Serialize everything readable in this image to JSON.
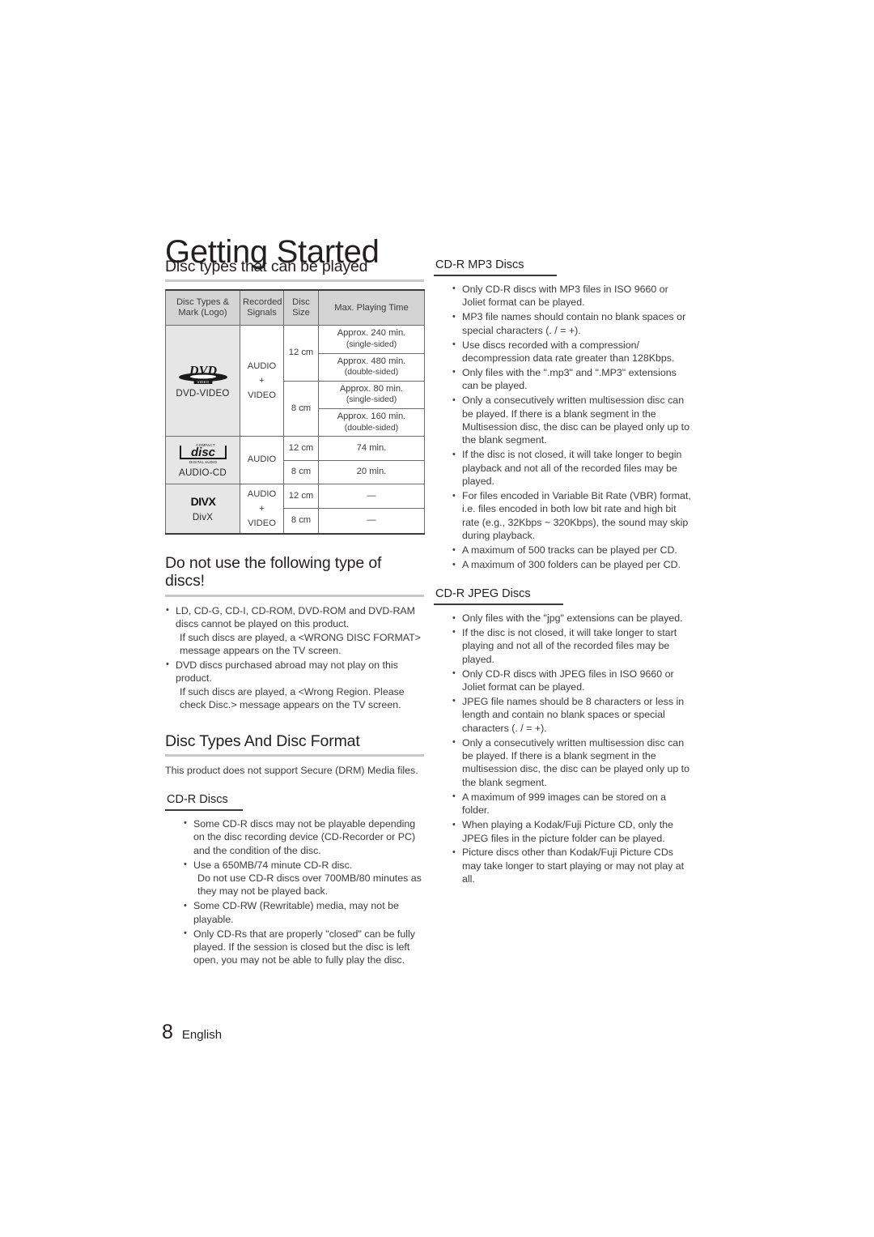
{
  "page": {
    "chapter_title": "Getting Started",
    "footer_page_number": "8",
    "footer_language": "English"
  },
  "left_column": {
    "heading_disc_types_played": "Disc types that can be played",
    "table": {
      "headers": [
        "Disc Types &\nMark (Logo)",
        "Recorded\nSignals",
        "Disc\nSize",
        "Max. Playing Time"
      ],
      "headers_flat": {
        "c1_line1": "Disc Types &",
        "c1_line2": "Mark (Logo)",
        "c2_line1": "Recorded",
        "c2_line2": "Signals",
        "c3_line1": "Disc",
        "c3_line2": "Size",
        "c4": "Max. Playing Time"
      },
      "rows": [
        {
          "logo": "dvd-video-logo",
          "logo_caption": "DVD-VIDEO",
          "signals_lines": [
            "AUDIO",
            "+",
            "VIDEO"
          ],
          "sizes": [
            {
              "size": "12 cm",
              "times": [
                {
                  "main": "Approx. 240 min.",
                  "sub": "(single-sided)"
                },
                {
                  "main": "Approx. 480 min.",
                  "sub": "(double-sided)"
                }
              ]
            },
            {
              "size": "8 cm",
              "times": [
                {
                  "main": "Approx. 80 min.",
                  "sub": "(single-sided)"
                },
                {
                  "main": "Approx. 160 min.",
                  "sub": "(double-sided)"
                }
              ]
            }
          ]
        },
        {
          "logo": "compact-disc-digital-audio-logo",
          "logo_caption": "AUDIO-CD",
          "signals_lines": [
            "AUDIO"
          ],
          "sizes": [
            {
              "size": "12 cm",
              "times": [
                {
                  "main": "74 min.",
                  "sub": ""
                }
              ]
            },
            {
              "size": "8 cm",
              "times": [
                {
                  "main": "20 min.",
                  "sub": ""
                }
              ]
            }
          ]
        },
        {
          "logo": "divx-logo",
          "logo_caption": "DivX",
          "signals_lines": [
            "AUDIO",
            "+",
            "VIDEO"
          ],
          "sizes": [
            {
              "size": "12 cm",
              "times": [
                {
                  "main": "—",
                  "sub": ""
                }
              ]
            },
            {
              "size": "8 cm",
              "times": [
                {
                  "main": "—",
                  "sub": ""
                }
              ]
            }
          ]
        }
      ]
    },
    "heading_do_not_use": "Do not use the following type of discs!",
    "do_not_use_bullets": [
      {
        "text": "LD, CD-G, CD-I, CD-ROM, DVD-ROM and DVD-RAM discs cannot be played on this product.",
        "cont": "If such discs are played, a <WRONG DISC FORMAT> message appears on the TV screen."
      },
      {
        "text": "DVD discs purchased abroad may not play on this product.",
        "cont": "If such discs are played, a <Wrong Region. Please check Disc.> message appears on the TV screen."
      }
    ],
    "heading_disc_types_format": "Disc Types And Disc Format",
    "drm_note": "This product does not support Secure (DRM) Media files.",
    "heading_cdr_discs": "CD-R Discs",
    "cdr_bullets": [
      {
        "text": "Some CD-R discs may not be playable depending on the disc recording device (CD-Recorder or PC) and the condition of the disc.",
        "cont": ""
      },
      {
        "text": "Use a 650MB/74 minute CD-R disc.",
        "cont": "Do not use CD-R discs over 700MB/80 minutes as they may not be played back."
      },
      {
        "text": "Some CD-RW (Rewritable) media, may not be playable.",
        "cont": ""
      },
      {
        "text": "Only CD-Rs that are properly \"closed\" can be fully played. If the session is closed but the disc is left open, you may not be able to fully play the disc.",
        "cont": ""
      }
    ]
  },
  "right_column": {
    "heading_cdr_mp3": "CD-R MP3 Discs",
    "mp3_bullets": [
      {
        "text": "Only CD-R discs with MP3 files in ISO 9660 or Joliet format can be played.",
        "cont": ""
      },
      {
        "text": "MP3 file names should contain no blank spaces or special characters (. / = +).",
        "cont": ""
      },
      {
        "text": "Use discs recorded with a compression/ decompression data rate greater than 128Kbps.",
        "cont": ""
      },
      {
        "text": "Only files with the \".mp3\" and \".MP3\" extensions can be played.",
        "cont": ""
      },
      {
        "text": "Only a consecutively written multisession disc can be played. If there is a blank segment in the Multisession disc, the disc can be played only up to the blank segment.",
        "cont": ""
      },
      {
        "text": "If the disc is not closed, it will take longer to begin playback and not all of the recorded files may be played.",
        "cont": ""
      },
      {
        "text": "For files encoded in Variable Bit Rate (VBR) format, i.e. files encoded in both low bit rate and high bit rate (e.g., 32Kbps ~ 320Kbps), the sound may skip during playback.",
        "cont": ""
      },
      {
        "text": "A maximum of 500 tracks can be played per CD.",
        "cont": ""
      },
      {
        "text": "A maximum of 300 folders can be played per CD.",
        "cont": ""
      }
    ],
    "heading_cdr_jpeg": "CD-R JPEG Discs",
    "jpeg_bullets": [
      {
        "text": "Only files with the \"jpg\" extensions can be played.",
        "cont": ""
      },
      {
        "text": "If the disc is not closed, it will take longer to start playing and not all of the recorded files may be played.",
        "cont": ""
      },
      {
        "text": "Only CD-R discs with JPEG files in ISO 9660 or Joliet format can be played.",
        "cont": ""
      },
      {
        "text": "JPEG file names should be 8 characters or less in length and contain no blank spaces or special characters (. / = +).",
        "cont": ""
      },
      {
        "text": "Only a consecutively written multisession disc can be played. If there is a blank segment in the multisession disc, the disc can be played only up to the blank segment.",
        "cont": ""
      },
      {
        "text": "A maximum of 999 images can be stored on a folder.",
        "cont": ""
      },
      {
        "text": "When playing a Kodak/Fuji Picture CD, only the JPEG files in the picture folder can be played.",
        "cont": ""
      },
      {
        "text": "Picture discs other than Kodak/Fuji Picture CDs may take longer to start playing or may not play at all.",
        "cont": ""
      }
    ]
  },
  "colors": {
    "text": "#3b3b3b",
    "heading": "#231f20",
    "table_header_bg": "#d4d4d4",
    "logo_cell_bg": "#e6e6e6",
    "rule_major": "#c9c9c9",
    "rule_minor": "#3a3a3a",
    "table_border": "#6c6c6c"
  }
}
